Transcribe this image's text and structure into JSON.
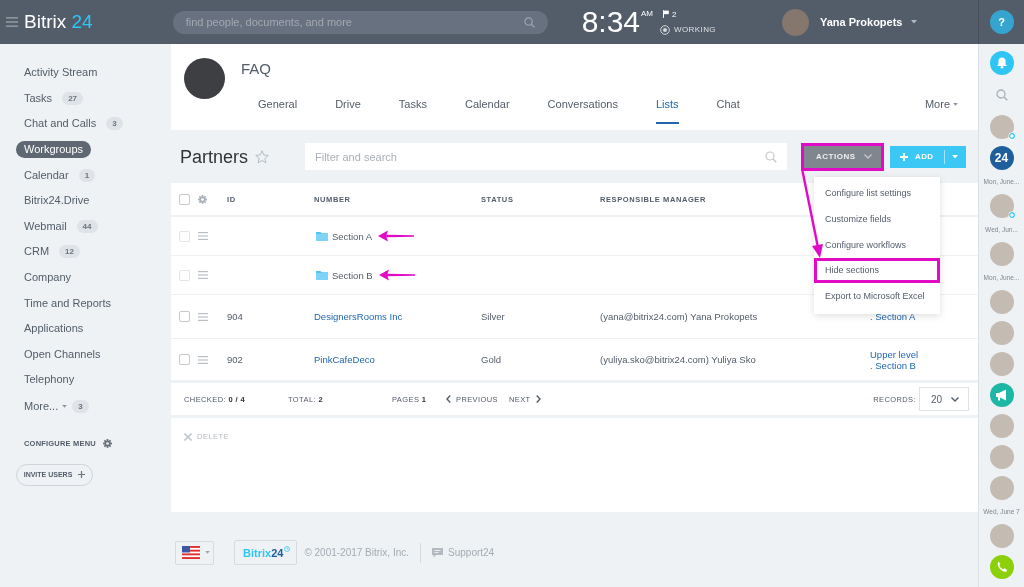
{
  "header": {
    "logo": {
      "brand": "Bitrix",
      "number": "24"
    },
    "search": {
      "placeholder": "find people, documents, and more"
    },
    "clock": {
      "time": "8:34",
      "period": "AM"
    },
    "flag_count": "2",
    "work_status": "WORKING",
    "user": {
      "name": "Yana Prokopets"
    }
  },
  "sidebar": {
    "items": [
      {
        "label": "Activity Stream",
        "selected": false
      },
      {
        "label": "Tasks",
        "count": "27",
        "selected": false
      },
      {
        "label": "Chat and Calls",
        "count": "3",
        "selected": false
      },
      {
        "label": "Workgroups",
        "selected": true
      },
      {
        "label": "Calendar",
        "count": "1",
        "selected": false
      },
      {
        "label": "Bitrix24.Drive",
        "selected": false
      },
      {
        "label": "Webmail",
        "count": "44",
        "selected": false
      },
      {
        "label": "CRM",
        "count": "12",
        "selected": false
      },
      {
        "label": "Company",
        "selected": false
      },
      {
        "label": "Time and Reports",
        "selected": false
      },
      {
        "label": "Applications",
        "selected": false
      },
      {
        "label": "Open Channels",
        "selected": false
      },
      {
        "label": "Telephony",
        "selected": false
      }
    ],
    "more": {
      "label": "More...",
      "count": "3"
    },
    "configure": "CONFIGURE MENU",
    "invite": "INVITE USERS"
  },
  "group": {
    "title": "FAQ",
    "tabs": [
      {
        "label": "General",
        "selected": false
      },
      {
        "label": "Drive",
        "selected": false
      },
      {
        "label": "Tasks",
        "selected": false
      },
      {
        "label": "Calendar",
        "selected": false
      },
      {
        "label": "Conversations",
        "selected": false
      },
      {
        "label": "Lists",
        "selected": true
      },
      {
        "label": "Chat",
        "selected": false
      }
    ],
    "more": "More"
  },
  "list": {
    "title": "Partners",
    "filter": {
      "placeholder": "Filter and search"
    },
    "actions": {
      "label": "ACTIONS",
      "highlighted": true
    },
    "add": "ADD"
  },
  "actions_menu": [
    {
      "label": "Configure list settings",
      "highlighted": false
    },
    {
      "label": "Customize fields",
      "highlighted": false
    },
    {
      "label": "Configure workflows",
      "highlighted": false
    },
    {
      "label": "Hide sections",
      "highlighted": true
    },
    {
      "label": "Export to Microsoft Excel",
      "highlighted": false
    }
  ],
  "table": {
    "all_checked": false,
    "columns": [
      "ID",
      "NUMBER",
      "STATUS",
      "RESPONSIBLE MANAGER"
    ],
    "rows": [
      {
        "kind": "section",
        "checked": false,
        "name": "Section A",
        "arrow": true
      },
      {
        "kind": "section",
        "checked": false,
        "name": "Section B",
        "arrow": true
      },
      {
        "kind": "item",
        "checked": false,
        "id": "904",
        "name": "DesignersRooms Inc",
        "status": "Silver",
        "manager": "(yana@bitrix24.com) Yana Prokopets",
        "section": [
          ". Section A"
        ]
      },
      {
        "kind": "item",
        "checked": false,
        "id": "902",
        "name": "PinkCafeDeco",
        "status": "Gold",
        "manager": "(yuliya.sko@bitrix24.com) Yuliya Sko",
        "section": [
          "Upper level",
          ". Section B"
        ]
      }
    ]
  },
  "summary": {
    "checked": "CHECKED: **0 / 4**",
    "total": "TOTAL: **2**",
    "pages": "PAGES **1**",
    "previous": "PREVIOUS",
    "next": "NEXT",
    "records_label": "RECORDS:",
    "records": "20"
  },
  "delete": {
    "label": "DELETE",
    "disabled": true
  },
  "footer": {
    "logo": {
      "brand": "Bitrix",
      "number": "24"
    },
    "copyright": "© 2001-2017 Bitrix, Inc.",
    "support": "Support24"
  },
  "rail": {
    "help": "?",
    "items": [
      {
        "kind": "notifications"
      },
      {
        "kind": "search"
      },
      {
        "kind": "avatar",
        "online": true
      },
      {
        "kind": "chat",
        "label": "24"
      },
      {
        "kind": "date",
        "label": "Mon, June..."
      },
      {
        "kind": "avatar",
        "online": true
      },
      {
        "kind": "date",
        "label": "Wed, Jun..."
      },
      {
        "kind": "avatar",
        "online": false
      },
      {
        "kind": "date",
        "label": "Mon, June..."
      },
      {
        "kind": "avatar",
        "online": false
      },
      {
        "kind": "avatar",
        "online": false
      },
      {
        "kind": "avatar",
        "online": false
      },
      {
        "kind": "announcement"
      },
      {
        "kind": "avatar",
        "online": false
      },
      {
        "kind": "avatar",
        "online": false
      },
      {
        "kind": "avatar",
        "online": false
      },
      {
        "kind": "date",
        "label": "Wed, June 7"
      },
      {
        "kind": "avatar",
        "online": false
      },
      {
        "kind": "call"
      }
    ]
  }
}
